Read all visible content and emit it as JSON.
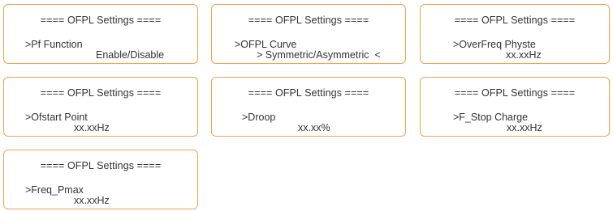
{
  "panels": [
    {
      "title": "==== OFPL Settings ====",
      "line1": ">Pf Function",
      "line2": "Enable/Disable"
    },
    {
      "title": "==== OFPL Settings ====",
      "line1": ">OFPL Curve",
      "line2": "> Symmetric/Asymmetric  <"
    },
    {
      "title": "==== OFPL Settings ====",
      "line1": ">OverFreq Physte",
      "line2": "xx.xxHz"
    },
    {
      "title": "==== OFPL Settings ====",
      "line1": ">Ofstart Point",
      "line2": "xx.xxHz"
    },
    {
      "title": "==== OFPL Settings ====",
      "line1": ">Droop",
      "line2": "xx.xx%"
    },
    {
      "title": "==== OFPL Settings ====",
      "line1": ">F_Stop Charge",
      "line2": "xx.xxHz"
    },
    {
      "title": "==== OFPL Settings ====",
      "line1": ">Freq_Pmax",
      "line2": "xx.xxHz"
    }
  ]
}
